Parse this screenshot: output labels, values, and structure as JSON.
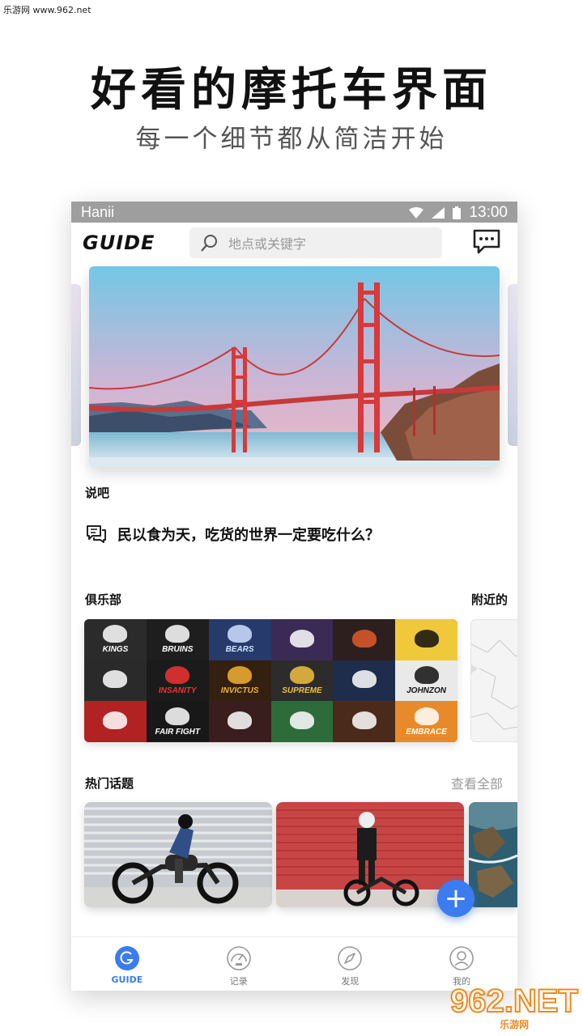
{
  "watermark": {
    "top_left": "乐游网 www.962.net",
    "logo": "962.NET",
    "logo_sub": "乐游网"
  },
  "promo": {
    "headline": "好看的摩托车界面",
    "subline": "每一个细节都从简洁开始"
  },
  "status": {
    "carrier": "Hanii",
    "time": "13:00"
  },
  "header": {
    "logo": "GUIDE",
    "search_placeholder": "地点或关键字"
  },
  "talk": {
    "label": "说吧",
    "quote": "民以食为天，吃货的世界一定要吃什么？"
  },
  "clubs": {
    "label": "俱乐部",
    "nearby_label": "附近的",
    "badges": [
      "KINGS",
      "BRUINS",
      "BEARS",
      "",
      "",
      "",
      "",
      "INSANITY",
      "INVICTUS",
      "SUPREME",
      "",
      "JOHNZON",
      "",
      "FAIR FIGHT",
      "",
      "",
      "",
      "EMBRACE"
    ]
  },
  "topics": {
    "label": "热门话题",
    "see_all": "查看全部"
  },
  "fab": {
    "label": "+"
  },
  "nav": [
    {
      "label": "GUIDE",
      "icon": "guide-icon",
      "active": true
    },
    {
      "label": "记录",
      "icon": "speedometer-icon",
      "active": false
    },
    {
      "label": "发现",
      "icon": "compass-icon",
      "active": false
    },
    {
      "label": "我的",
      "icon": "profile-icon",
      "active": false
    }
  ],
  "colors": {
    "accent": "#3b7cf0",
    "status_bar": "#9e9e9e",
    "bridge": "#d8393a"
  }
}
